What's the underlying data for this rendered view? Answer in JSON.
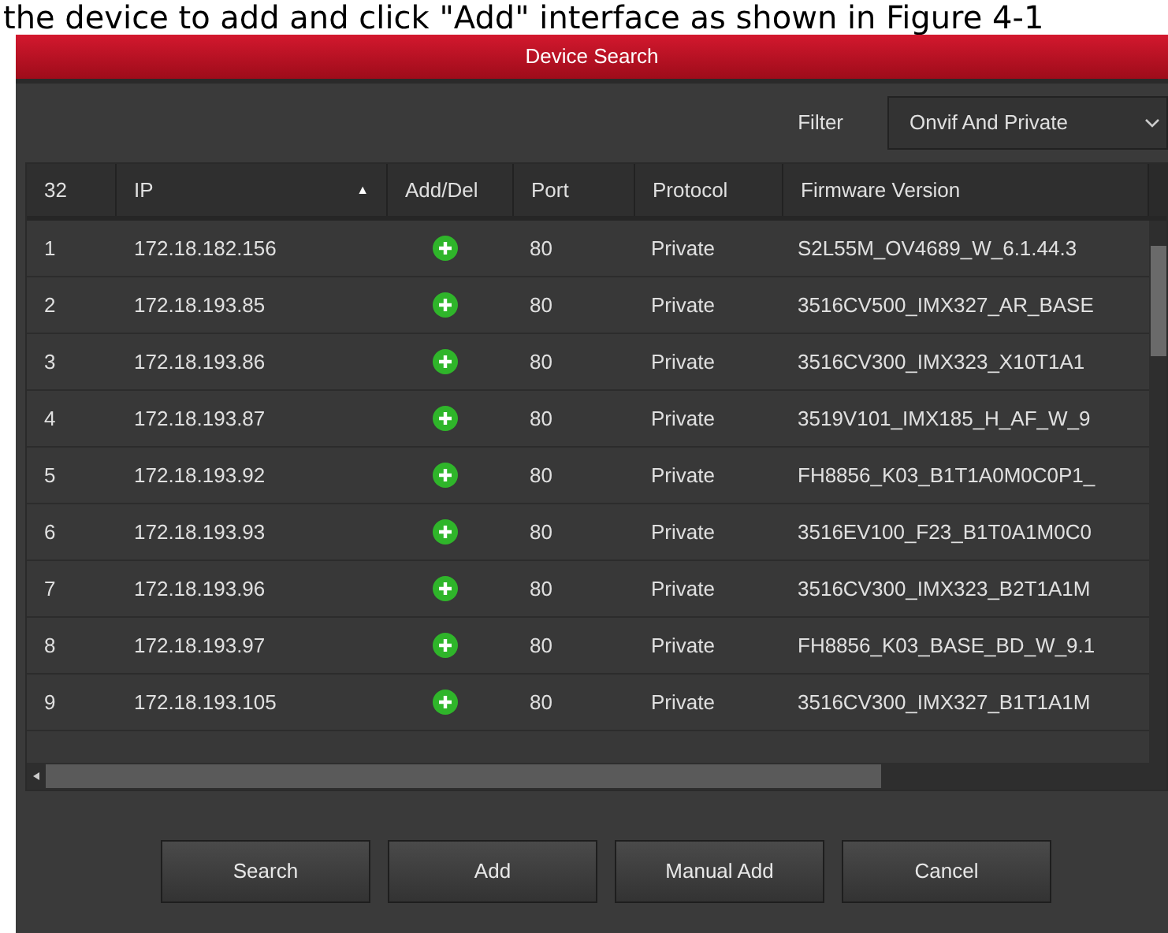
{
  "document_text": "the device to add and click \"Add\" interface as shown in Figure 4-1",
  "window": {
    "title": "Device Search"
  },
  "filter": {
    "label": "Filter",
    "value": "Onvif And Private"
  },
  "table": {
    "columns": [
      {
        "label": "32"
      },
      {
        "label": "IP",
        "sort": "▲"
      },
      {
        "label": "Add/Del"
      },
      {
        "label": "Port"
      },
      {
        "label": "Protocol"
      },
      {
        "label": "Firmware Version"
      }
    ],
    "rows": [
      {
        "no": "1",
        "ip": "172.18.182.156",
        "port": "80",
        "protocol": "Private",
        "firmware": "S2L55M_OV4689_W_6.1.44.3"
      },
      {
        "no": "2",
        "ip": "172.18.193.85",
        "port": "80",
        "protocol": "Private",
        "firmware": "3516CV500_IMX327_AR_BASE"
      },
      {
        "no": "3",
        "ip": "172.18.193.86",
        "port": "80",
        "protocol": "Private",
        "firmware": "3516CV300_IMX323_X10T1A1"
      },
      {
        "no": "4",
        "ip": "172.18.193.87",
        "port": "80",
        "protocol": "Private",
        "firmware": "3519V101_IMX185_H_AF_W_9"
      },
      {
        "no": "5",
        "ip": "172.18.193.92",
        "port": "80",
        "protocol": "Private",
        "firmware": "FH8856_K03_B1T1A0M0C0P1_"
      },
      {
        "no": "6",
        "ip": "172.18.193.93",
        "port": "80",
        "protocol": "Private",
        "firmware": "3516EV100_F23_B1T0A1M0C0"
      },
      {
        "no": "7",
        "ip": "172.18.193.96",
        "port": "80",
        "protocol": "Private",
        "firmware": "3516CV300_IMX323_B2T1A1M"
      },
      {
        "no": "8",
        "ip": "172.18.193.97",
        "port": "80",
        "protocol": "Private",
        "firmware": "FH8856_K03_BASE_BD_W_9.1"
      },
      {
        "no": "9",
        "ip": "172.18.193.105",
        "port": "80",
        "protocol": "Private",
        "firmware": "3516CV300_IMX327_B1T1A1M"
      }
    ]
  },
  "buttons": [
    "Search",
    "Add",
    "Manual Add",
    "Cancel"
  ]
}
